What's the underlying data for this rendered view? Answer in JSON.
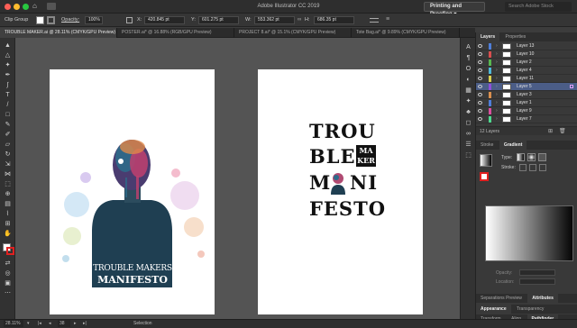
{
  "window": {
    "title": "Adobe Illustrator CC 2019",
    "workspace": "Printing and Proofing",
    "search_placeholder": "Search Adobe Stock"
  },
  "control_bar": {
    "selection": "Clip Group",
    "opacity_label": "Opacity:",
    "opacity_value": "100%",
    "x_label": "X:",
    "x_value": "420.845 pt",
    "y_label": "Y:",
    "y_value": "601.275 pt",
    "w_label": "W:",
    "w_value": "553.362 pt",
    "h_label": "H:",
    "h_value": "686.35 pt"
  },
  "doc_tabs": [
    "TROUBLE MAKER.ai @ 28.11% (CMYK/GPU Preview)",
    "POSTER.ai* @ 16.88% (RGB/GPU Preview)",
    "PROJECT 8.ai* @ 15.1% (CMYK/GPU Preview)",
    "Tote Bag.ai* @ 9.89% (CMYK/GPU Preview)"
  ],
  "artboard_left": {
    "line1": "TROUBLE MAKERS",
    "line2": "MANIFESTO"
  },
  "artboard_right": {
    "row1": "TROU",
    "row2": "BLE",
    "row2_box_a": "MA",
    "row2_box_b": "KER",
    "row3_a": "M",
    "row3_b": "NI",
    "row4": "FESTO"
  },
  "layers_panel": {
    "tabs": [
      "Layers",
      "Properties"
    ],
    "layers": [
      {
        "name": "Layer 13",
        "color": "#4f7ed9"
      },
      {
        "name": "Layer 10",
        "color": "#d94f4f"
      },
      {
        "name": "Layer 2",
        "color": "#58b84f"
      },
      {
        "name": "Layer 4",
        "color": "#4fb8d9"
      },
      {
        "name": "Layer 11",
        "color": "#d9cf4f"
      },
      {
        "name": "Layer 5",
        "color": "#8e4fd9"
      },
      {
        "name": "Layer 3",
        "color": "#d98f4f"
      },
      {
        "name": "Layer 1",
        "color": "#4f7ed9"
      },
      {
        "name": "Layer 9",
        "color": "#d94f9f"
      },
      {
        "name": "Layer 7",
        "color": "#4fd98f"
      }
    ],
    "count": "12 Layers"
  },
  "stroke_gradient": {
    "tabs": [
      "Stroke",
      "Gradient"
    ],
    "type_label": "Type:",
    "stroke_label": "Stroke:",
    "opacity_label": "Opacity:",
    "location_label": "Location:"
  },
  "bottom_panels": {
    "row1": [
      "Separations Preview",
      "Attributes"
    ],
    "row2": [
      "Appearance",
      "Transparency"
    ],
    "row3": [
      "Transform",
      "Align",
      "Pathfinder"
    ]
  },
  "status": {
    "zoom": "28.11%",
    "artboard": "38",
    "tool": "Selection"
  }
}
